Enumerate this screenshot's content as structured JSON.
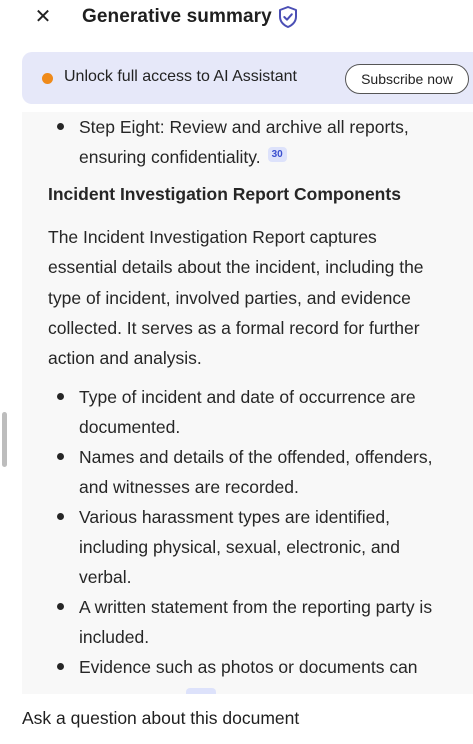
{
  "header": {
    "close_symbol": "✕",
    "title": "Generative summary",
    "shield_icon": "shield-check-icon"
  },
  "banner": {
    "text": "Unlock full access to AI Assistant",
    "button_label": "Subscribe now",
    "dot_color": "#ef8a1a"
  },
  "summary": {
    "top_bullets": [
      {
        "text": "Step Eight: Review and archive all reports, ensuring confidentiality.",
        "cite": "30"
      }
    ],
    "heading": "Incident Investigation Report Components",
    "paragraph": "The Incident Investigation Report captures essential details about the incident, including the type of incident, involved parties, and evidence collected. It serves as a formal record for further action and analysis.",
    "bullets": [
      {
        "text": "Type of incident and date of occurrence are documented."
      },
      {
        "text": "Names and details of the offended, offenders, and witnesses are recorded."
      },
      {
        "text": "Various harassment types are identified, including physical, sexual, electronic, and verbal."
      },
      {
        "text": "A written statement from the reporting party is included."
      },
      {
        "text": "Evidence such as photos or documents can"
      }
    ]
  },
  "footer": {
    "ask_label": "Ask a question about this document"
  }
}
